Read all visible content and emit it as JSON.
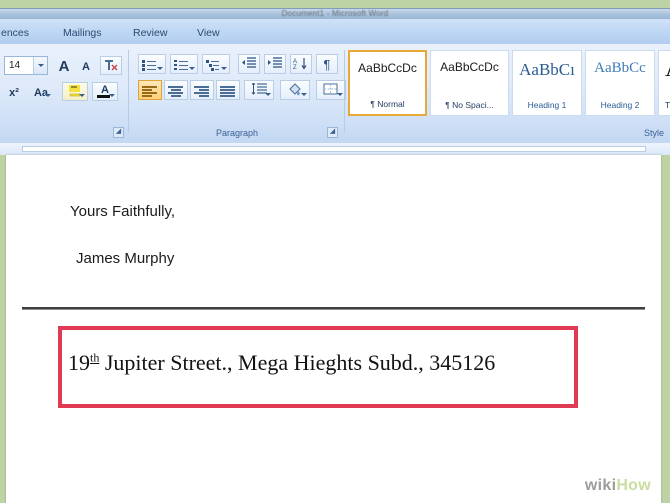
{
  "window": {
    "title": "Document1 - Microsoft Word"
  },
  "ribbon": {
    "tabs": [
      {
        "label": "ences",
        "name": "tab-references",
        "active": false
      },
      {
        "label": "Mailings",
        "name": "tab-mailings",
        "active": false
      },
      {
        "label": "Review",
        "name": "tab-review",
        "active": false
      },
      {
        "label": "View",
        "name": "tab-view",
        "active": false
      }
    ],
    "font_group": {
      "label": "",
      "size_value": "14",
      "grow_font": "A",
      "shrink_font": "A",
      "clear_formatting": "clear-formatting",
      "superscript": "x",
      "change_case": "Aa",
      "highlight": "ab",
      "font_color": "A"
    },
    "paragraph_group": {
      "label": "Paragraph",
      "bullets": "bullets",
      "numbering": "numbering",
      "multilevel": "multilevel-list",
      "decrease_indent": "decrease-indent",
      "increase_indent": "increase-indent",
      "sort": "sort",
      "show_marks": "¶",
      "align_left": "align-left",
      "align_center": "align-center",
      "align_right": "align-right",
      "justify": "justify",
      "line_spacing": "line-spacing",
      "shading": "shading",
      "borders": "borders"
    },
    "styles_group": {
      "label": "Style",
      "items": [
        {
          "sample": "AaBbCcDc",
          "name": "¶ Normal",
          "selected": true
        },
        {
          "sample": "AaBbCcDc",
          "name": "¶ No Spaci...",
          "selected": false
        },
        {
          "sample": "AaBbCı",
          "name": "Heading 1",
          "selected": false
        },
        {
          "sample": "AaBbCc",
          "name": "Heading 2",
          "selected": false
        },
        {
          "sample": "A",
          "name": "T",
          "selected": false
        }
      ]
    }
  },
  "document": {
    "paragraphs": [
      {
        "text": "Yours Faithfully,"
      },
      {
        "text": "James Murphy"
      }
    ],
    "address": {
      "number": "19",
      "ordinal_suffix": "th",
      "rest": " Jupiter Street., Mega Hieghts Subd., 345126"
    }
  },
  "watermark": {
    "part1": "wiki",
    "part2": "How"
  },
  "colors": {
    "background_green": "#bed3a5",
    "tab_blue": "#bdd6f3",
    "ribbon_blue": "#dfeafa",
    "annotation_red": "#e03a54",
    "style_selected_orange": "#e9a83a"
  }
}
